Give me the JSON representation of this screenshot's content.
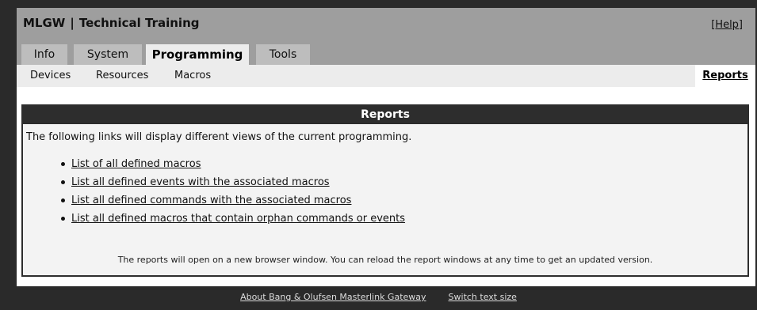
{
  "header": {
    "app_name": "MLGW",
    "separator": "|",
    "subtitle": "Technical Training",
    "help_label": "[Help]"
  },
  "tabs": [
    {
      "label": "Info"
    },
    {
      "label": "System"
    },
    {
      "label": "Programming",
      "active": true
    },
    {
      "label": "Tools"
    }
  ],
  "subnav": {
    "items": [
      {
        "label": "Devices"
      },
      {
        "label": "Resources"
      },
      {
        "label": "Macros"
      }
    ],
    "active_label": "Reports"
  },
  "panel": {
    "title": "Reports",
    "intro": "The following links will display different views of the current programming.",
    "links": [
      {
        "label": "List of all defined macros"
      },
      {
        "label": "List all defined events with the associated macros"
      },
      {
        "label": "List all defined commands with the associated macros"
      },
      {
        "label": "List all defined macros that contain orphan commands or events"
      }
    ],
    "note": "The reports will open on a new browser window. You can reload the report windows at any time to get an updated version."
  },
  "footer": {
    "about_label": "About Bang & Olufsen Masterlink Gateway",
    "text_size_label": "Switch text size"
  }
}
